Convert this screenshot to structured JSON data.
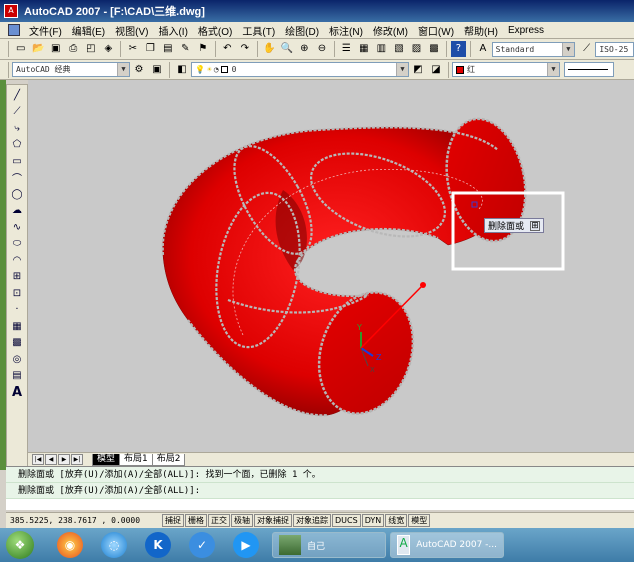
{
  "window": {
    "title": "AutoCAD 2007 - [F:\\CAD\\三维.dwg]"
  },
  "menu": [
    "文件(F)",
    "编辑(E)",
    "视图(V)",
    "插入(I)",
    "格式(O)",
    "工具(T)",
    "绘图(D)",
    "标注(N)",
    "修改(M)",
    "窗口(W)",
    "帮助(H)",
    "Express"
  ],
  "toolbar": {
    "text_style": "Standard",
    "dim_style": "ISO-25",
    "workspace": "AutoCAD 经典",
    "layer": "0",
    "color": "红"
  },
  "canvas": {
    "tooltip": "删除面或",
    "tooltip_button": "⊞",
    "ucs_labels": {
      "x": "X",
      "y": "Y",
      "z": "Z"
    }
  },
  "tabs": [
    "模型",
    "布局1",
    "布局2"
  ],
  "command": {
    "history": "删除面或 [放弃(U)/添加(A)/全部(ALL)]: 找到一个面，已删除 1 个。",
    "prompt": "删除面或 [放弃(U)/添加(A)/全部(ALL)]:"
  },
  "status": {
    "coords": "385.5225,  238.7617 , 0.0000",
    "buttons": [
      "捕捉",
      "栅格",
      "正交",
      "极轴",
      "对象捕捉",
      "对象追踪",
      "DUCS",
      "DYN",
      "线宽",
      "模型"
    ]
  },
  "taskbar": {
    "items": [
      {
        "label": "自己"
      },
      {
        "label": "AutoCAD 2007 -..."
      }
    ]
  },
  "colors": {
    "object": "#e00000",
    "canvas": "#c9c9c9",
    "highlight_box": "#ffffff"
  }
}
